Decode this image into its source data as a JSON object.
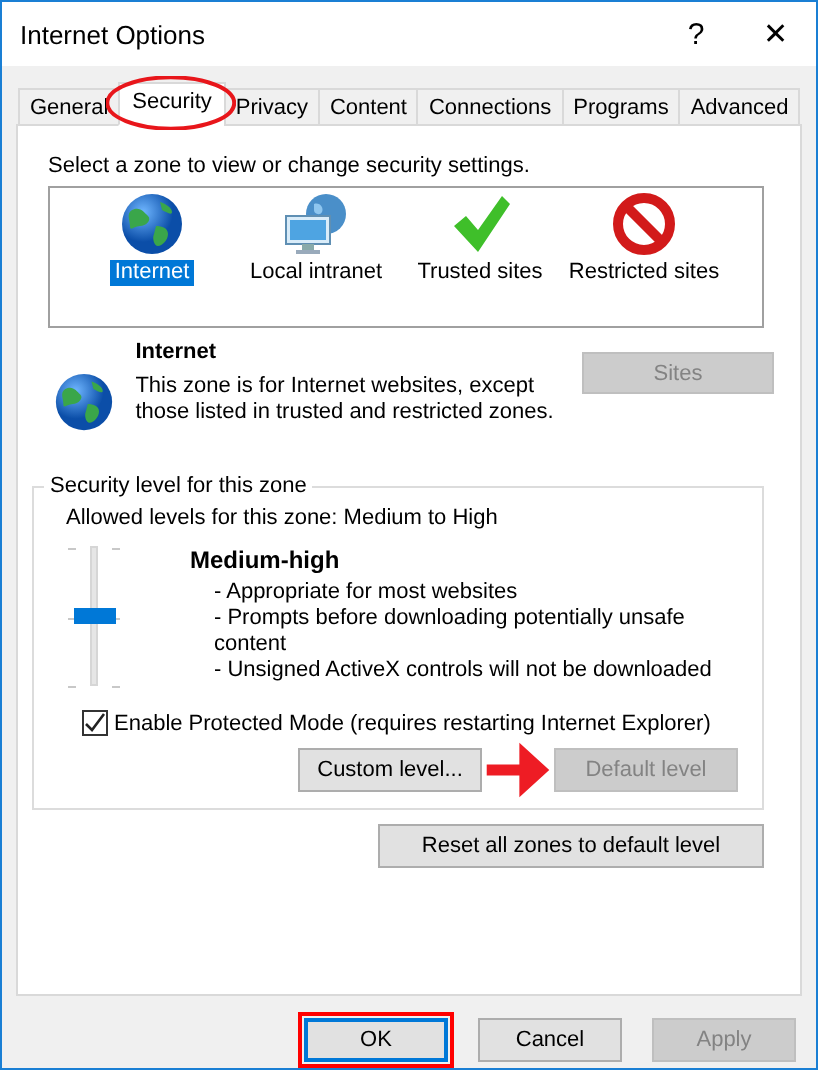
{
  "window": {
    "title": "Internet Options",
    "help": "?",
    "close": "✕"
  },
  "tabs": [
    {
      "label": "General",
      "selected": false,
      "circled": false
    },
    {
      "label": "Security",
      "selected": true,
      "circled": true
    },
    {
      "label": "Privacy",
      "selected": false,
      "circled": false
    },
    {
      "label": "Content",
      "selected": false,
      "circled": false
    },
    {
      "label": "Connections",
      "selected": false,
      "circled": false
    },
    {
      "label": "Programs",
      "selected": false,
      "circled": false
    },
    {
      "label": "Advanced",
      "selected": false,
      "circled": false
    }
  ],
  "zone_prompt": "Select a zone to view or change security settings.",
  "zones": [
    {
      "kind": "internet",
      "label": "Internet",
      "selected": true
    },
    {
      "kind": "intranet",
      "label": "Local intranet",
      "selected": false
    },
    {
      "kind": "trusted",
      "label": "Trusted sites",
      "selected": false
    },
    {
      "kind": "restricted",
      "label": "Restricted sites",
      "selected": false
    }
  ],
  "zone_info": {
    "kind": "internet",
    "name": "Internet",
    "description": "This zone is for Internet websites, except those listed in trusted and restricted zones.",
    "sites_button": {
      "label": "Sites",
      "disabled": true
    }
  },
  "security_level": {
    "title": "Security level for this zone",
    "allowed": "Allowed levels for this zone: Medium to High",
    "level": 0.5,
    "level_name": "Medium-high",
    "details": [
      "- Appropriate for most websites",
      "- Prompts before downloading potentially unsafe content",
      "- Unsigned ActiveX controls will not be downloaded"
    ],
    "protected_mode": {
      "label": "Enable Protected Mode (requires restarting Internet Explorer)",
      "checked": true
    },
    "buttons": [
      {
        "label": "Custom level...",
        "disabled": false,
        "arrow": false
      },
      {
        "label": "Default level",
        "disabled": true,
        "arrow": true
      }
    ]
  },
  "reset_button": {
    "label": "Reset all zones to default level",
    "disabled": false
  },
  "footer_buttons": [
    {
      "label": "OK",
      "disabled": false,
      "default": true,
      "highlighted": true
    },
    {
      "label": "Cancel",
      "disabled": false,
      "default": false,
      "highlighted": false
    },
    {
      "label": "Apply",
      "disabled": true,
      "default": false,
      "highlighted": false
    }
  ]
}
